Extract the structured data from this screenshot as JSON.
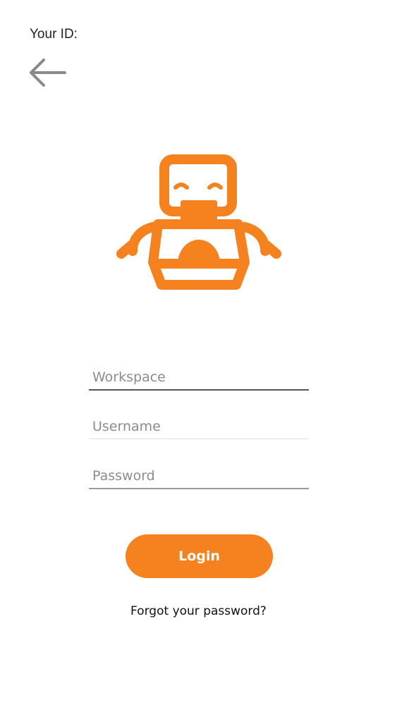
{
  "header": {
    "id_label": "Your ID:"
  },
  "icons": {
    "back": "arrow-left-icon",
    "logo": "robot-logo-icon"
  },
  "form": {
    "workspace_placeholder": "Workspace",
    "username_placeholder": "Username",
    "password_placeholder": "Password",
    "login_label": "Login",
    "forgot_label": "Forgot your password?"
  },
  "colors": {
    "accent": "#f5821f",
    "text": "#222222",
    "placeholder": "#8c8c8c",
    "back_arrow": "#8a8a8a"
  }
}
